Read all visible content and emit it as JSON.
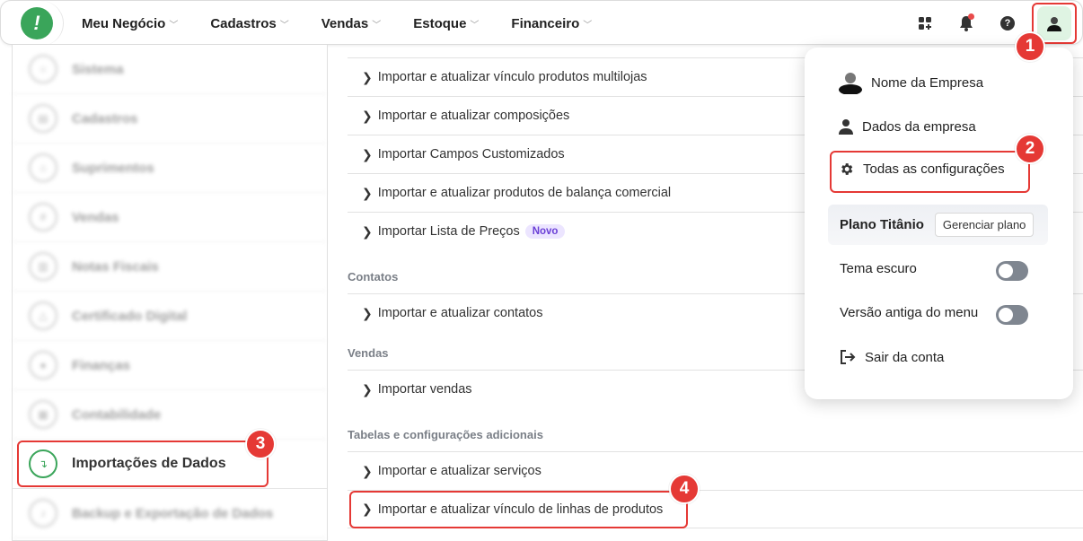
{
  "nav": {
    "items": [
      {
        "label": "Meu Negócio"
      },
      {
        "label": "Cadastros"
      },
      {
        "label": "Vendas"
      },
      {
        "label": "Estoque"
      },
      {
        "label": "Financeiro"
      }
    ]
  },
  "badges": {
    "b1": "1",
    "b2": "2",
    "b3": "3",
    "b4": "4"
  },
  "sidebar": {
    "items": [
      {
        "label": "Sistema"
      },
      {
        "label": "Cadastros"
      },
      {
        "label": "Suprimentos"
      },
      {
        "label": "Vendas"
      },
      {
        "label": "Notas Fiscais"
      },
      {
        "label": "Certificado Digital"
      },
      {
        "label": "Finanças"
      },
      {
        "label": "Contabilidade"
      },
      {
        "label": "Importações de Dados"
      },
      {
        "label": "Backup e Exportação de Dados"
      }
    ]
  },
  "main": {
    "rows": [
      "Importar e atualizar vínculo produtos multilojas",
      "Importar e atualizar composições",
      "Importar Campos Customizados",
      "Importar e atualizar produtos de balança comercial",
      "Importar Lista de Preços"
    ],
    "novo_label": "Novo",
    "section_contatos": "Contatos",
    "contatos_rows": [
      "Importar e atualizar contatos"
    ],
    "section_vendas": "Vendas",
    "vendas_rows": [
      "Importar vendas"
    ],
    "section_tabelas": "Tabelas e configurações adicionais",
    "tabelas_rows": [
      "Importar e atualizar serviços",
      "Importar e atualizar vínculo de linhas de produtos"
    ]
  },
  "dropdown": {
    "company_name": "Nome da Empresa",
    "company_data": "Dados da empresa",
    "all_settings": "Todas as configurações",
    "plan_label": "Plano Titânio",
    "manage_plan": "Gerenciar plano",
    "dark_theme": "Tema escuro",
    "old_menu": "Versão antiga do menu",
    "logout": "Sair da conta"
  },
  "colors": {
    "accent": "#3aa55a",
    "highlight": "#e53935",
    "novo_bg": "#ece5ff",
    "novo_text": "#6a3fd6"
  }
}
